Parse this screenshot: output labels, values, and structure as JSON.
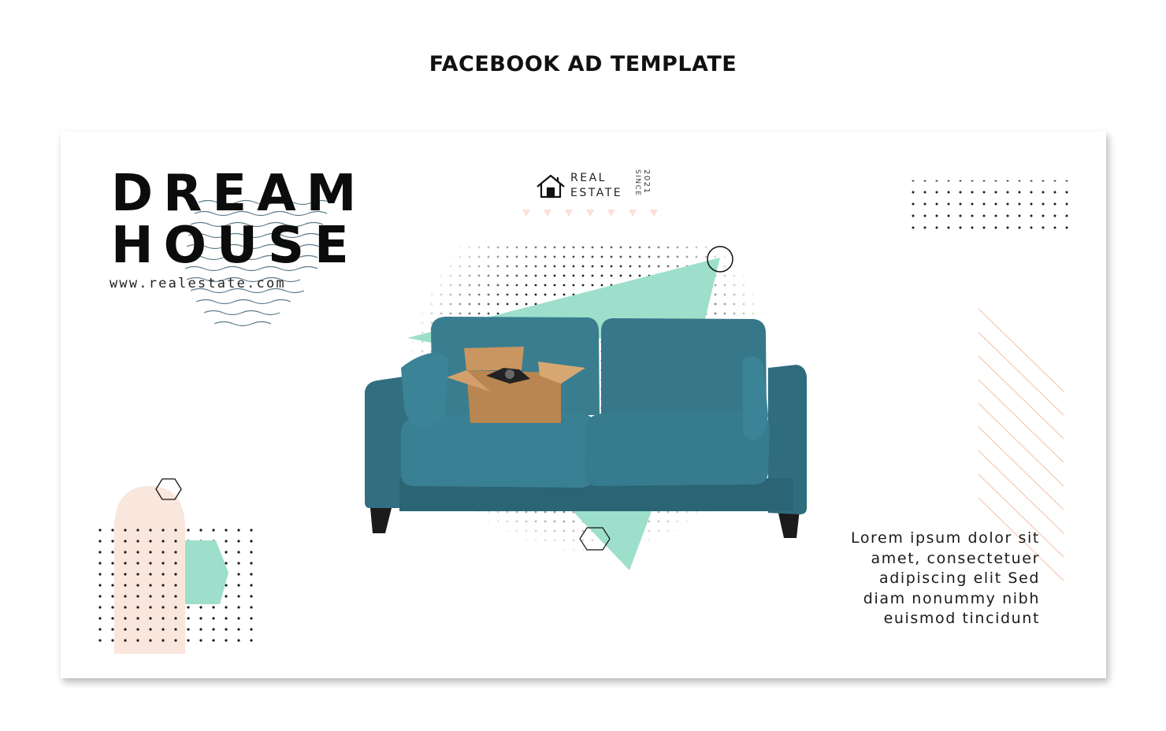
{
  "page": {
    "title": "FACEBOOK AD TEMPLATE"
  },
  "ad": {
    "headline_line1": "DREAM",
    "headline_line2": "HOUSE",
    "website": "www.realestate.com",
    "brand": {
      "line1": "REAL",
      "line2": "ESTATE",
      "since_label": "SINCE",
      "year": "2021"
    },
    "body_text": [
      "Lorem ipsum dolor sit",
      "amet, consectetuer",
      "adipiscing elit Sed",
      "diam nonummy nibh",
      "euismod tincidunt"
    ],
    "image": "teal-sofa-with-cardboard-box"
  },
  "colors": {
    "mint": "#9ddfcb",
    "peach": "#f9e6dc",
    "sofa": "#2f6f80",
    "box": "#b98651",
    "text": "#0c0c0c"
  },
  "icons": [
    "house-icon",
    "circle-outline",
    "hexagon-outline"
  ]
}
